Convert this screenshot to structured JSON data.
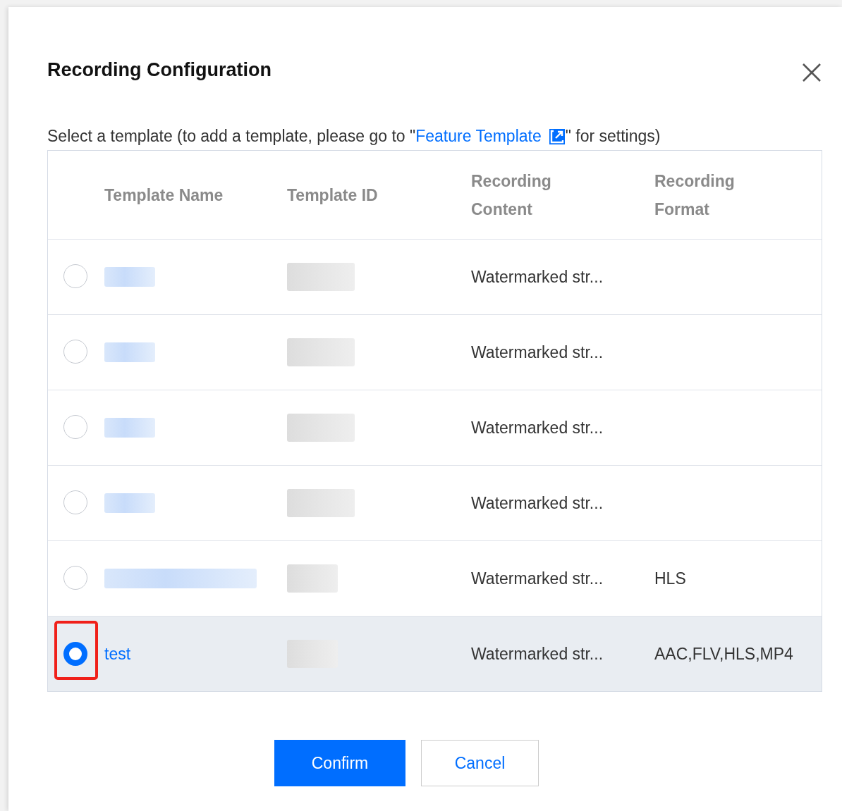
{
  "dialog": {
    "title": "Recording Configuration"
  },
  "instruction": {
    "before": "Select a template (to add a template, please go to \"",
    "link": "Feature Template",
    "after": "\" for settings)"
  },
  "table": {
    "columns": [
      "Template Name",
      "Template ID",
      "Recording Content",
      "Recording Format"
    ],
    "rows": [
      {
        "selected": false,
        "name": {
          "kind": "redacted"
        },
        "id": {
          "kind": "redacted_wide"
        },
        "content": "Watermarked str..."
      },
      {
        "selected": false,
        "name": {
          "kind": "redacted"
        },
        "id": {
          "kind": "redacted_wide"
        },
        "content": "Watermarked str..."
      },
      {
        "selected": false,
        "name": {
          "kind": "redacted"
        },
        "id": {
          "kind": "redacted_wide"
        },
        "content": "Watermarked str..."
      },
      {
        "selected": false,
        "name": {
          "kind": "redacted"
        },
        "id": {
          "kind": "redacted_wide"
        },
        "content": "Watermarked str..."
      },
      {
        "selected": false,
        "name": {
          "kind": "redacted_wide"
        },
        "id": {
          "kind": "redacted"
        },
        "content": "Watermarked str...",
        "format": "HLS"
      },
      {
        "selected": true,
        "highlighted": true,
        "name": {
          "kind": "text",
          "text": "test"
        },
        "id": {
          "kind": "redacted"
        },
        "content": "Watermarked str...",
        "format": "AAC,FLV,HLS,MP4"
      }
    ]
  },
  "buttons": [
    {
      "label": "Confirm",
      "kind": "primary"
    },
    {
      "label": "Cancel",
      "kind": "secondary"
    }
  ]
}
